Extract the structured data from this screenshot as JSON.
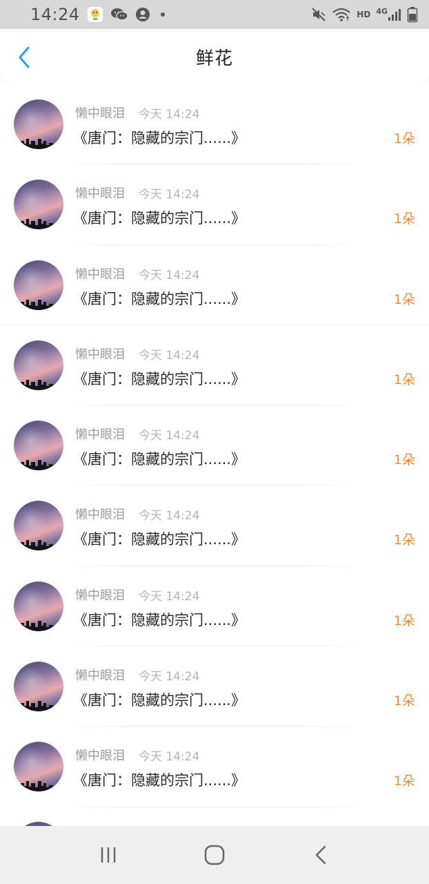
{
  "status_bar": {
    "time": "14:24",
    "left_icons": [
      "app-notification-icon",
      "wechat-icon",
      "account-icon",
      "dot-icon"
    ],
    "right_icons": [
      "mute-icon",
      "wifi-icon",
      "hd-icon",
      "signal-4g-icon",
      "battery-icon"
    ],
    "hd_label": "HD",
    "network_label": "4G"
  },
  "header": {
    "title": "鲜花",
    "accent_color": "#2a9df4"
  },
  "items": [
    {
      "username": "懒中眼泪",
      "time": "今天 14:24",
      "book": "《唐门：隐藏的宗门......》",
      "count": "1朵"
    },
    {
      "username": "懒中眼泪",
      "time": "今天 14:24",
      "book": "《唐门：隐藏的宗门......》",
      "count": "1朵"
    },
    {
      "username": "懒中眼泪",
      "time": "今天 14:24",
      "book": "《唐门：隐藏的宗门......》",
      "count": "1朵"
    },
    {
      "username": "懒中眼泪",
      "time": "今天 14:24",
      "book": "《唐门：隐藏的宗门......》",
      "count": "1朵"
    },
    {
      "username": "懒中眼泪",
      "time": "今天 14:24",
      "book": "《唐门：隐藏的宗门......》",
      "count": "1朵"
    },
    {
      "username": "懒中眼泪",
      "time": "今天 14:24",
      "book": "《唐门：隐藏的宗门......》",
      "count": "1朵"
    },
    {
      "username": "懒中眼泪",
      "time": "今天 14:24",
      "book": "《唐门：隐藏的宗门......》",
      "count": "1朵"
    },
    {
      "username": "懒中眼泪",
      "time": "今天 14:24",
      "book": "《唐门：隐藏的宗门......》",
      "count": "1朵"
    },
    {
      "username": "懒中眼泪",
      "time": "今天 14:24",
      "book": "《唐门：隐藏的宗门......》",
      "count": "1朵"
    }
  ],
  "count_color": "#f08a3c",
  "nav_bar": {
    "buttons": [
      "recent-apps-icon",
      "home-icon",
      "back-nav-icon"
    ]
  }
}
